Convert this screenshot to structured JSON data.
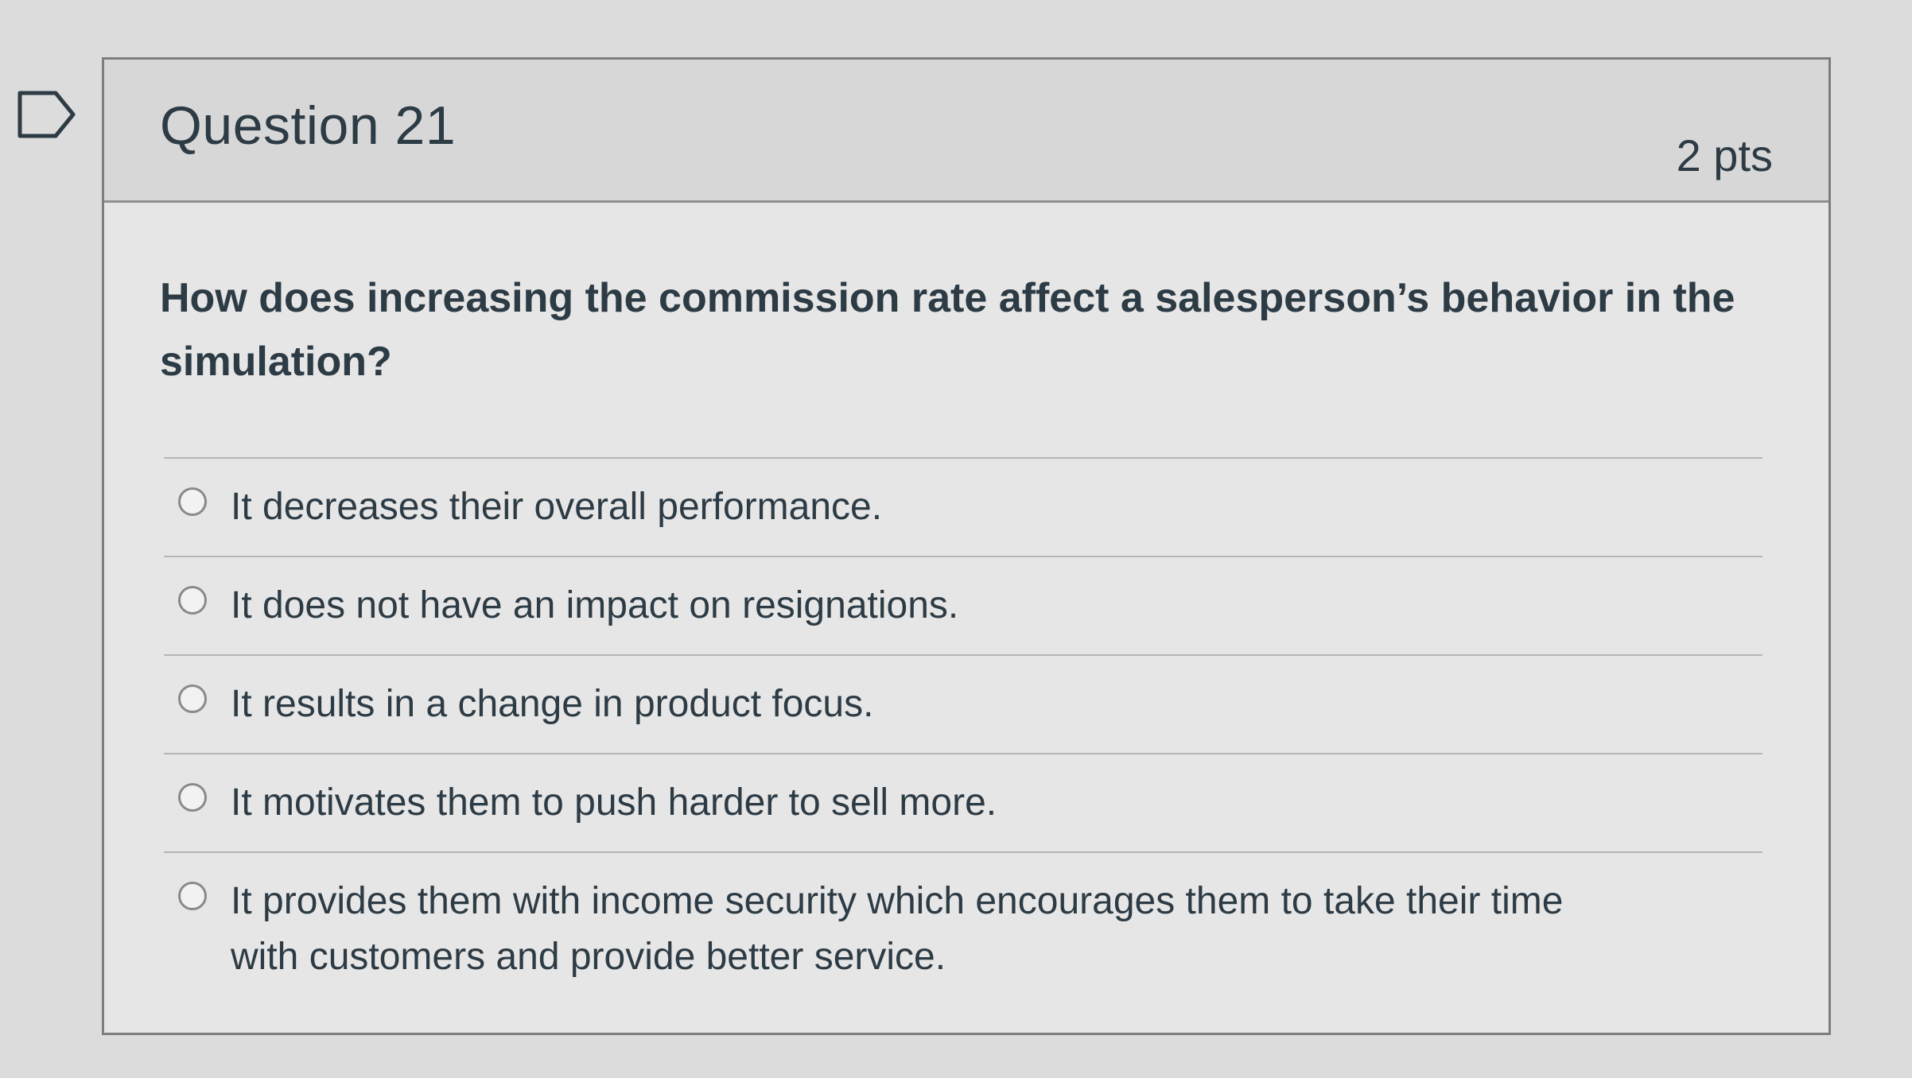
{
  "icons": {
    "flag": "flag-outline-icon",
    "radio": "radio-unchecked-icon"
  },
  "question": {
    "title": "Question 21",
    "points": "2 pts",
    "text": "How does increasing the commission rate affect a salesperson’s behavior in the simulation?"
  },
  "answers": [
    {
      "label": "It decreases their overall performance."
    },
    {
      "label": "It does not have an impact on resignations."
    },
    {
      "label": "It results in a change in product focus."
    },
    {
      "label": "It motivates them to push harder to sell more."
    },
    {
      "label": "It provides them with income security which encourages them to take their time with customers and provide better service."
    }
  ],
  "colors": {
    "text": "#2d3b45",
    "header_bg": "#d7d7d7",
    "card_bg": "#e6e6e6",
    "border": "#7d7d7d"
  }
}
